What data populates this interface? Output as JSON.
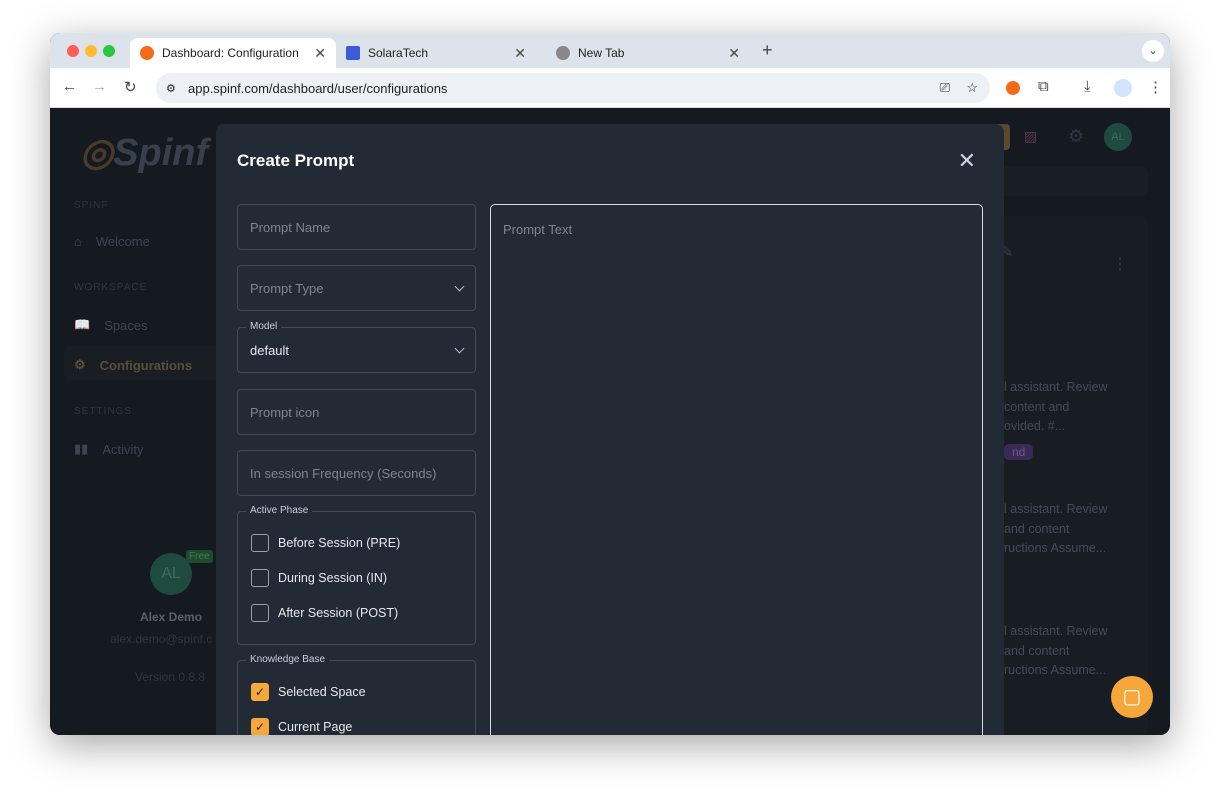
{
  "browser": {
    "tabs": [
      {
        "label": "Dashboard: Configuration",
        "active": true
      },
      {
        "label": "SolaraTech"
      },
      {
        "label": "New Tab"
      }
    ],
    "url": "app.spinf.com/dashboard/user/configurations"
  },
  "sidebar": {
    "logo": "Spinf",
    "sections": [
      {
        "title": "SPINF",
        "items": [
          "Welcome"
        ]
      },
      {
        "title": "WORKSPACE",
        "items": [
          "Spaces",
          "Configurations"
        ]
      },
      {
        "title": "SETTINGS",
        "items": [
          "Activity"
        ]
      }
    ],
    "active": "Configurations",
    "user": {
      "initials": "AL",
      "badge": "Free",
      "name": "Alex Demo",
      "email": "alex.demo@spinf.c"
    },
    "version": "Version 0.8.8"
  },
  "header": {
    "avatar": "AL"
  },
  "background": {
    "snippets": [
      "l assistant. Review",
      "content and",
      "ovided. #...",
      "nd",
      "l assistant. Review",
      "and content",
      "ructions Assume...",
      "l assistant. Review",
      "and content",
      "ructions Assume..."
    ]
  },
  "modal": {
    "title": "Create Prompt",
    "prompt_name_placeholder": "Prompt Name",
    "prompt_type_placeholder": "Prompt Type",
    "model_label": "Model",
    "model_value": "default",
    "icon_placeholder": "Prompt icon",
    "frequency_placeholder": "In session Frequency (Seconds)",
    "active_phase": {
      "label": "Active Phase",
      "options": [
        {
          "label": "Before Session (PRE)",
          "checked": false
        },
        {
          "label": "During Session (IN)",
          "checked": false
        },
        {
          "label": "After Session (POST)",
          "checked": false
        }
      ]
    },
    "knowledge_base": {
      "label": "Knowledge Base",
      "options": [
        {
          "label": "Selected Space",
          "checked": true
        },
        {
          "label": "Current Page",
          "checked": true
        }
      ]
    },
    "prompt_text_placeholder": "Prompt Text"
  },
  "colors": {
    "accent": "#f5a73b",
    "modal_bg": "#222b35",
    "backdrop": "#151a21"
  }
}
